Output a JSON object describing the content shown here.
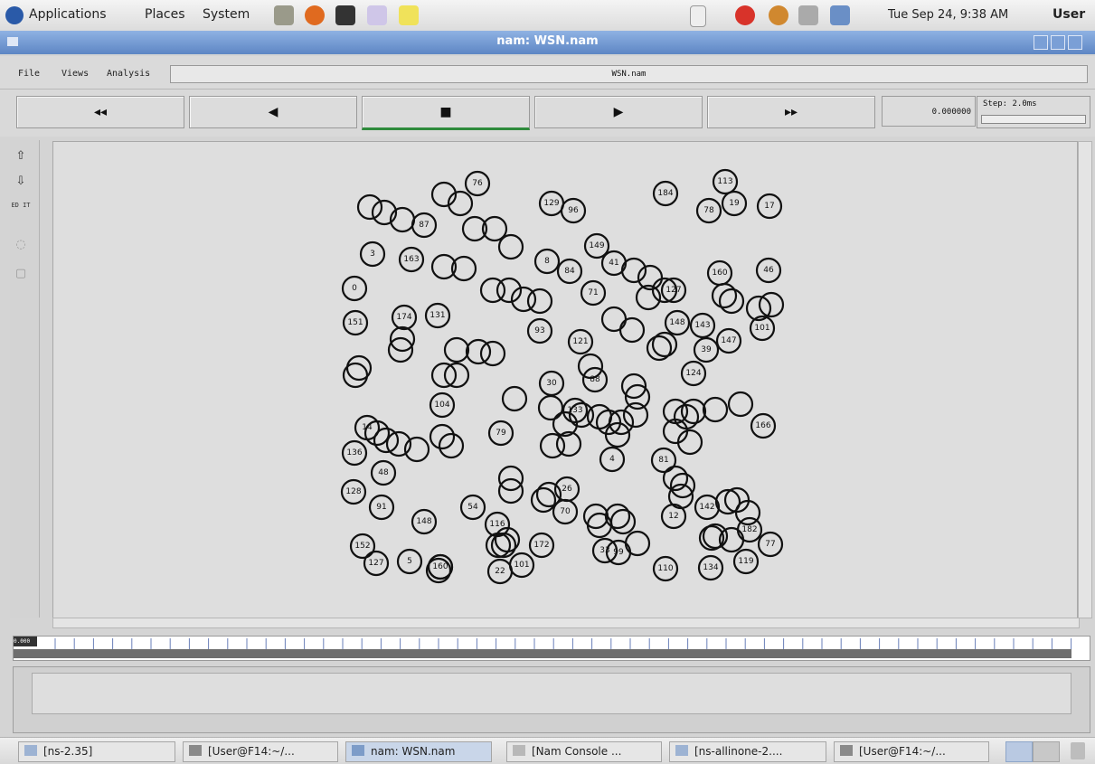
{
  "top_panel": {
    "menus": [
      "Applications",
      "Places",
      "System"
    ],
    "clock": "Tue Sep 24,  9:38 AM",
    "user": "User"
  },
  "window": {
    "title": "nam: WSN.nam"
  },
  "menubar": {
    "items": [
      "File",
      "Views",
      "Analysis"
    ],
    "filename": "WSN.nam"
  },
  "controls": {
    "rewind": "◂◂",
    "back": "◀",
    "stop": "■",
    "play": "▶",
    "fast_forward": "▸▸",
    "time": "0.000000",
    "step_label": "Step: 2.0ms",
    "step_slider_text": "(slider)"
  },
  "left_toolbar": {
    "edit_label": "ED IT"
  },
  "timeline": {
    "marker_text": "0.000"
  },
  "taskbar": {
    "items": [
      "[ns-2.35]",
      "[User@F14:~/...",
      "nam: WSN.nam",
      "[Nam Console ...",
      "[ns-allinone-2....",
      "[User@F14:~/..."
    ]
  },
  "network": {
    "nodes": [
      "76",
      "184",
      "113",
      "19",
      "17",
      "129",
      "96",
      "78",
      "87",
      "149",
      "3",
      "163",
      "41",
      "8",
      "84",
      "160",
      "46",
      "0",
      "71",
      "127",
      "131",
      "174",
      "148",
      "143",
      "147",
      "101",
      "151",
      "93",
      "121",
      "39",
      "124",
      "88",
      "30",
      "104",
      "166",
      "79",
      "133",
      "136",
      "48",
      "4",
      "81",
      "128",
      "91",
      "54",
      "12",
      "142",
      "148",
      "116",
      "26",
      "70",
      "182",
      "152",
      "127",
      "5",
      "160",
      "22",
      "101",
      "172",
      "99",
      "119",
      "110",
      "33",
      "134",
      "77",
      "14"
    ]
  }
}
